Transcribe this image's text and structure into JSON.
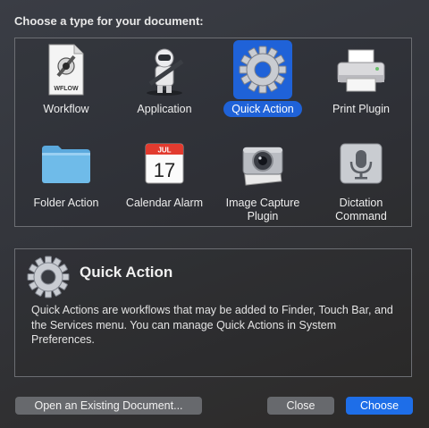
{
  "window": {
    "prompt": "Choose a type for your document:"
  },
  "types": [
    {
      "label": "Workflow",
      "badge": "WFLOW",
      "selected": false
    },
    {
      "label": "Application",
      "selected": false
    },
    {
      "label": "Quick Action",
      "selected": true
    },
    {
      "label": "Print Plugin",
      "selected": false
    },
    {
      "label": "Folder Action",
      "selected": false
    },
    {
      "label": "Calendar Alarm",
      "month": "JUL",
      "day": "17",
      "selected": false
    },
    {
      "label": "Image Capture\nPlugin",
      "selected": false
    },
    {
      "label": "Dictation\nCommand",
      "selected": false
    }
  ],
  "description": {
    "title": "Quick Action",
    "text": "Quick Actions are workflows that may be added to Finder, Touch Bar, and the Services menu. You can manage Quick Actions in System Preferences."
  },
  "buttons": {
    "open_existing": "Open an Existing Document...",
    "close": "Close",
    "choose": "Choose"
  },
  "colors": {
    "accent": "#1f62d8",
    "button": "#67696d",
    "primary_button": "#1e6ee8"
  }
}
